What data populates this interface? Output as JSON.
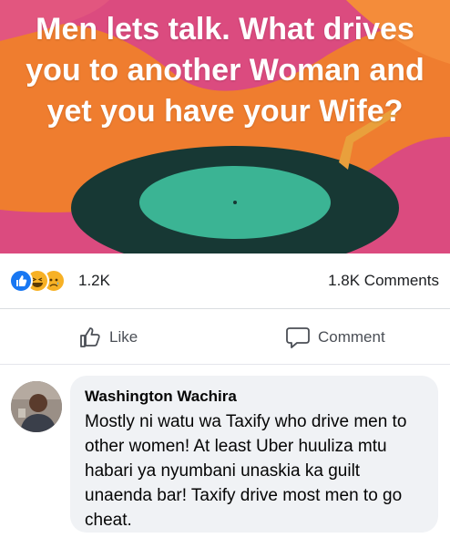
{
  "post": {
    "text": "Men lets talk.  What drives you to another Woman and yet you have your Wife?",
    "colors": {
      "pink": "#d9487e",
      "orange": "#ef7d2f",
      "disc": "#183b38",
      "label": "#38b493"
    }
  },
  "reactions": {
    "icons": [
      "like-icon",
      "haha-icon",
      "sad-icon"
    ],
    "count": "1.2K",
    "comments_count": "1.8K Comments"
  },
  "actions": {
    "like_label": "Like",
    "comment_label": "Comment"
  },
  "comment": {
    "author": "Washington Wachira",
    "text": "Mostly ni watu wa Taxify who drive men to other women! At least Uber huuliza mtu habari ya nyumbani unaskia ka guilt unaenda bar! Taxify drive most men to go cheat."
  }
}
